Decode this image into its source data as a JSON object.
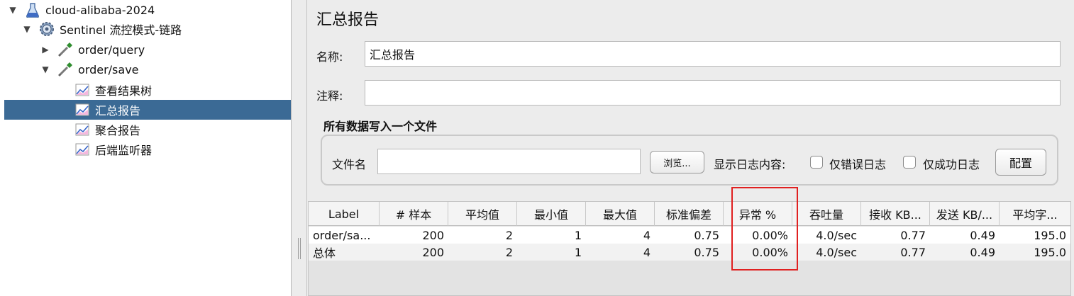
{
  "tree": {
    "items": [
      {
        "label": "cloud-alibaba-2024",
        "toggle": "▼",
        "icon": "flask-icon"
      },
      {
        "label": "Sentinel 流控模式-链路",
        "toggle": "▼",
        "icon": "gear-icon"
      },
      {
        "label": "order/query",
        "toggle": "▶",
        "icon": "pipette-icon"
      },
      {
        "label": "order/save",
        "toggle": "▼",
        "icon": "pipette-icon"
      },
      {
        "label": "查看结果树",
        "toggle": "",
        "icon": "chart-icon"
      },
      {
        "label": "汇总报告",
        "toggle": "",
        "icon": "chart-icon"
      },
      {
        "label": "聚合报告",
        "toggle": "",
        "icon": "chart-icon"
      },
      {
        "label": "后端监听器",
        "toggle": "",
        "icon": "chart-icon"
      }
    ]
  },
  "panel": {
    "title": "汇总报告",
    "name_label": "名称:",
    "name_value": "汇总报告",
    "comment_label": "注释:",
    "comment_value": "",
    "file_group_title": "所有数据写入一个文件",
    "filename_label": "文件名",
    "filename_value": "",
    "browse_button": "浏览...",
    "log_content_label": "显示日志内容:",
    "errors_only_label": "仅错误日志",
    "success_only_label": "仅成功日志",
    "config_button": "配置"
  },
  "table": {
    "columns": [
      "Label",
      "# 样本",
      "平均值",
      "最小值",
      "最大值",
      "标准偏差",
      "异常 %",
      "吞吐量",
      "接收 KB...",
      "发送 KB/...",
      "平均字..."
    ],
    "rows": [
      [
        "order/sa...",
        "200",
        "2",
        "1",
        "4",
        "0.75",
        "0.00%",
        "4.0/sec",
        "0.77",
        "0.49",
        "195.0"
      ],
      [
        "总体",
        "200",
        "2",
        "1",
        "4",
        "0.75",
        "0.00%",
        "4.0/sec",
        "0.77",
        "0.49",
        "195.0"
      ]
    ]
  },
  "colors": {
    "selection": "#3b6a95",
    "highlight_box": "#e02020"
  }
}
